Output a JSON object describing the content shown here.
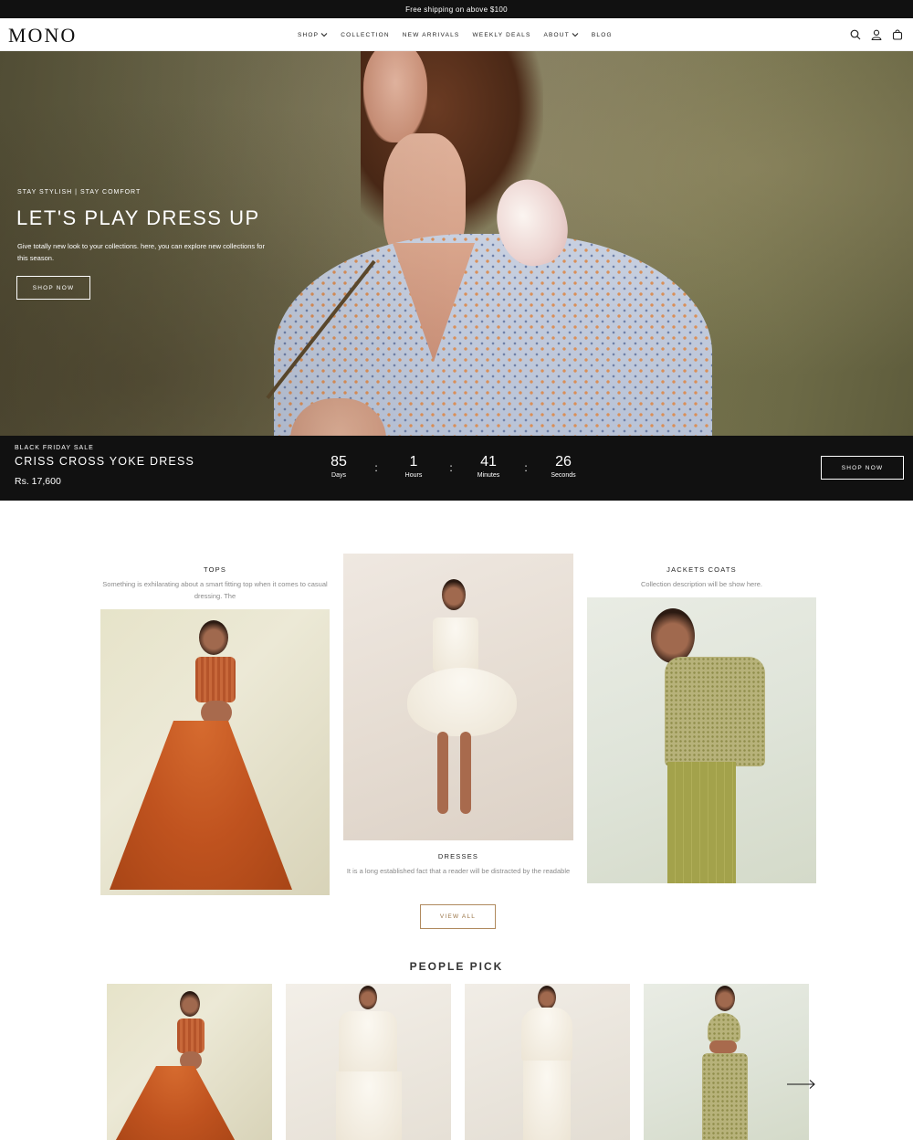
{
  "announcement": "Free shipping on above $100",
  "brand": {
    "logo": "MONO"
  },
  "nav": {
    "items": [
      {
        "label": "SHOP",
        "has_dropdown": true
      },
      {
        "label": "COLLECTION",
        "has_dropdown": false
      },
      {
        "label": "NEW ARRIVALS",
        "has_dropdown": false
      },
      {
        "label": "WEEKLY DEALS",
        "has_dropdown": false
      },
      {
        "label": "ABOUT",
        "has_dropdown": true
      },
      {
        "label": "BLOG",
        "has_dropdown": false
      }
    ],
    "icons": [
      "search-icon",
      "account-icon",
      "cart-icon"
    ]
  },
  "hero": {
    "kicker": "STAY STYLISH | STAY COMFORT",
    "title": "LET'S PLAY DRESS UP",
    "description": "Give totally new look to your collections. here, you can explore new collections for this season.",
    "button": "SHOP NOW"
  },
  "sale": {
    "kicker": "BLACK FRIDAY SALE",
    "product": "CRISS CROSS YOKE DRESS",
    "price": "Rs. 17,600",
    "countdown": {
      "days": {
        "value": "85",
        "label": "Days"
      },
      "hours": {
        "value": "1",
        "label": "Hours"
      },
      "minutes": {
        "value": "41",
        "label": "Minutes"
      },
      "seconds": {
        "value": "26",
        "label": "Seconds"
      },
      "separator": ":"
    },
    "button": "SHOP NOW"
  },
  "collections": {
    "tops": {
      "title": "TOPS",
      "description": "Something is exhilarating about a smart fitting top when it comes to casual dressing. The"
    },
    "dresses": {
      "title": "DRESSES",
      "description": "It is a long established fact that a reader will be distracted by the readable"
    },
    "jackets": {
      "title": "JACKETS COATS",
      "description": "Collection description will be show here."
    },
    "view_all": "VIEW ALL"
  },
  "people_pick": {
    "title": "PEOPLE PICK",
    "arrow_icon": "arrow-right-icon"
  },
  "colors": {
    "dark": "#111111",
    "accent_bronze": "#9a7446"
  }
}
